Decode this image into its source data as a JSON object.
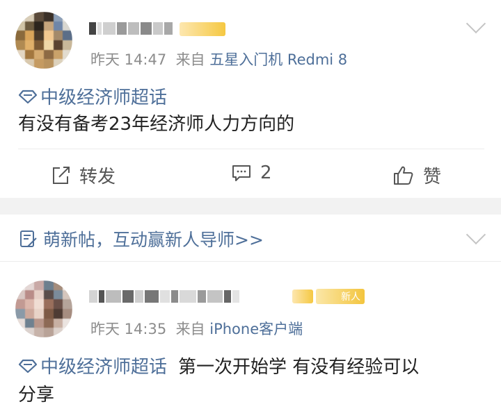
{
  "post1": {
    "meta_time": "昨天 14:47",
    "meta_from": "来自",
    "meta_source": "五星入门机 Redmi 8",
    "topic": "中级经济师超话",
    "text": "有没有备考23年经济师人力方向的",
    "actions": {
      "repost": "转发",
      "comment_count": "2",
      "like": "赞"
    }
  },
  "banner": {
    "text": "萌新帖，互动赢新人导师>>"
  },
  "post2": {
    "badge_text": "新人",
    "meta_time": "昨天 14:35",
    "meta_from": "来自",
    "meta_source": "iPhone客户端",
    "topic": "中级经济师超话",
    "text_line1": "第一次开始学 有没有经验可以",
    "text_line2": "分享"
  },
  "colors": {
    "link_blue": "#4e6f99",
    "vip_gold": "#f5c842",
    "separator": "#f2f2f2"
  }
}
